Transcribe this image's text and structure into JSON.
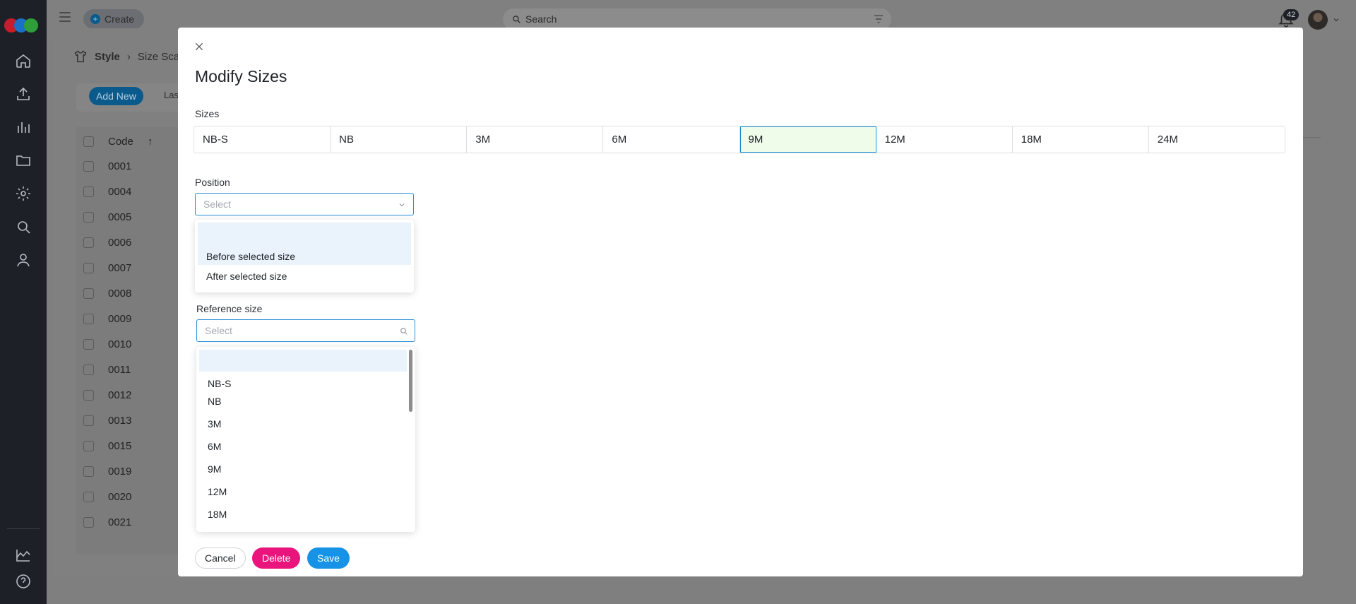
{
  "topbar": {
    "create_label": "Create",
    "search_placeholder": "Search",
    "notification_count": "42"
  },
  "background": {
    "breadcrumb": [
      "Style",
      "Size Scal"
    ],
    "add_new_label": "Add New",
    "last_label": "Las",
    "table_header": "Code",
    "codes": [
      "0001",
      "0004",
      "0005",
      "0006",
      "0007",
      "0008",
      "0009",
      "0010",
      "0011",
      "0012",
      "0013",
      "0015",
      "0019",
      "0020",
      "0021"
    ]
  },
  "modal": {
    "title": "Modify Sizes",
    "sizes_label": "Sizes",
    "sizes": [
      "NB-S",
      "NB",
      "3M",
      "6M",
      "9M",
      "12M",
      "18M",
      "24M"
    ],
    "selected_size": "9M",
    "position": {
      "label": "Position",
      "placeholder": "Select",
      "options": [
        "Before selected size",
        "After selected size"
      ]
    },
    "reference": {
      "label": "Reference size",
      "placeholder": "Select",
      "options": [
        "NB-S",
        "NB",
        "3M",
        "6M",
        "9M",
        "12M",
        "18M"
      ]
    },
    "buttons": {
      "cancel": "Cancel",
      "delete": "Delete",
      "save": "Save"
    }
  },
  "colors": {
    "primary": "#1693e6",
    "danger": "#e9157c",
    "selected_cell_bg": "#eefce9",
    "sidebar_bg": "#1d2127"
  }
}
